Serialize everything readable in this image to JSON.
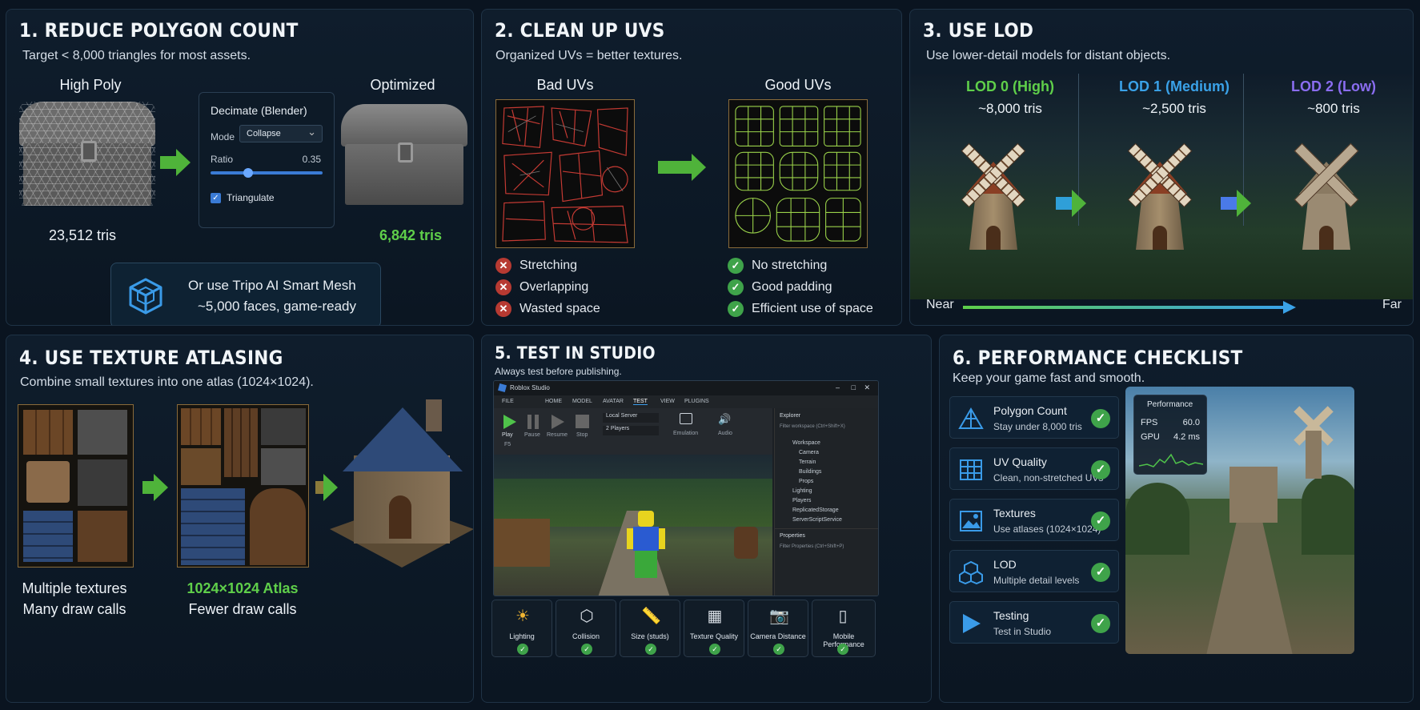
{
  "p1": {
    "title": "1. REDUCE POLYGON COUNT",
    "subtitle": "Target < 8,000 triangles for most assets.",
    "high_label": "High Poly",
    "opt_label": "Optimized",
    "high_tris": "23,512 tris",
    "opt_tris": "6,842 tris",
    "decimate": {
      "title": "Decimate (Blender)",
      "mode_label": "Mode",
      "mode_value": "Collapse",
      "ratio_label": "Ratio",
      "ratio_value": "0.35",
      "ratio_level": 0.35,
      "triangulate_label": "Triangulate",
      "triangulate_checked": true
    },
    "tripo": {
      "line1": "Or use Tripo AI Smart Mesh",
      "line2": "~5,000 faces, game-ready"
    }
  },
  "p2": {
    "title": "2. CLEAN UP UVS",
    "subtitle": "Organized UVs = better textures.",
    "bad_label": "Bad UVs",
    "good_label": "Good UVs",
    "bad_items": [
      "Stretching",
      "Overlapping",
      "Wasted space"
    ],
    "good_items": [
      "No stretching",
      "Good padding",
      "Efficient use of space"
    ]
  },
  "p3": {
    "title": "3. USE LOD",
    "subtitle": "Use lower-detail models for distant objects.",
    "lods": [
      {
        "label": "LOD 0 (High)",
        "tris": "~8,000 tris",
        "color": "#5fcf4a"
      },
      {
        "label": "LOD 1 (Medium)",
        "tris": "~2,500 tris",
        "color": "#3aa2e8"
      },
      {
        "label": "LOD 2 (Low)",
        "tris": "~800 tris",
        "color": "#8a6df0"
      }
    ],
    "near": "Near",
    "far": "Far"
  },
  "p4": {
    "title": "4. USE TEXTURE ATLASING",
    "subtitle": "Combine small textures into one atlas (1024×1024).",
    "multi1": "Multiple textures",
    "multi2": "Many draw calls",
    "atlas1": "1024×1024 Atlas",
    "atlas2": "Fewer draw calls"
  },
  "p5": {
    "title": "5. TEST IN STUDIO",
    "subtitle": "Always test before publishing.",
    "window_title": "Roblox Studio",
    "menu": [
      "FILE",
      "HOME",
      "MODEL",
      "AVATAR",
      "TEST",
      "VIEW",
      "PLUGINS"
    ],
    "ribbon": {
      "play": "Play",
      "play_key": "F5",
      "pause": "Pause",
      "resume": "Resume",
      "stop": "Stop",
      "server": "Local Server",
      "players": "2 Players",
      "emulation": "Emulation",
      "audio": "Audio"
    },
    "explorer": {
      "title": "Explorer",
      "filter": "Filter workspace (Ctrl+Shift+X)",
      "items": [
        "Workspace",
        "Camera",
        "Terrain",
        "Buildings",
        "Props",
        "Lighting",
        "Players",
        "ReplicatedStorage",
        "ServerScriptService"
      ]
    },
    "properties": {
      "title": "Properties",
      "filter": "Filter Properties (Ctrl+Shift+P)"
    },
    "checks": [
      "Lighting",
      "Collision",
      "Size (studs)",
      "Texture Quality",
      "Camera Distance",
      "Mobile Performance"
    ]
  },
  "p6": {
    "title": "6. PERFORMANCE CHECKLIST",
    "subtitle": "Keep your game fast and smooth.",
    "items": [
      {
        "title": "Polygon Count",
        "sub": "Stay under 8,000 tris",
        "icon": "triangle-icon"
      },
      {
        "title": "UV Quality",
        "sub": "Clean, non-stretched UVs",
        "icon": "grid-icon"
      },
      {
        "title": "Textures",
        "sub": "Use atlases (1024×1024)",
        "icon": "image-icon"
      },
      {
        "title": "LOD",
        "sub": "Multiple detail levels",
        "icon": "cubes-icon"
      },
      {
        "title": "Testing",
        "sub": "Test in Studio",
        "icon": "play-icon"
      }
    ],
    "perf": {
      "title": "Performance",
      "fps_label": "FPS",
      "fps_value": "60.0",
      "gpu_label": "GPU",
      "gpu_value": "4.2 ms"
    }
  },
  "colors": {
    "accent_green": "#5fcf4a",
    "accent_blue": "#3aa2e8",
    "accent_purple": "#8a6df0",
    "bad_red": "#b73a32"
  }
}
